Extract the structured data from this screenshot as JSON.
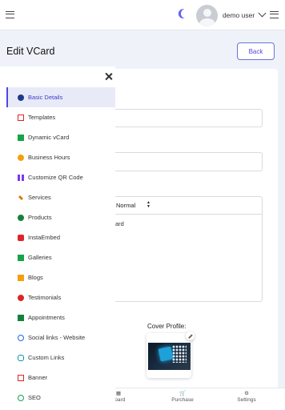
{
  "header": {
    "user_name": "demo user",
    "icons": {
      "menu": "hamburger-icon",
      "theme": "moon-icon",
      "user_menu": "chevron-down-icon",
      "options": "more-menu-icon"
    }
  },
  "page": {
    "title": "Edit VCard",
    "back_label": "Back"
  },
  "form": {
    "editor_format": "Normal",
    "editor_text": "ard",
    "cover_label": "Cover Profile:"
  },
  "sidebar": {
    "items": [
      {
        "label": "Basic Details",
        "icon": "question-circle-icon",
        "color": "#1e3a8a",
        "active": true
      },
      {
        "label": "Templates",
        "icon": "template-icon",
        "color": "#dc2626"
      },
      {
        "label": "Dynamic vCard",
        "icon": "dynamic-vcard-icon",
        "color": "#16a34a"
      },
      {
        "label": "Business Hours",
        "icon": "clock-icon",
        "color": "#f59e0b"
      },
      {
        "label": "Customize QR Code",
        "icon": "qr-code-icon",
        "color": "#7c3aed"
      },
      {
        "label": "Services",
        "icon": "wrench-icon",
        "color": "#d97706"
      },
      {
        "label": "Products",
        "icon": "product-icon",
        "color": "#15803d"
      },
      {
        "label": "InstaEmbed",
        "icon": "instagram-icon",
        "color": "#dc2626"
      },
      {
        "label": "Galleries",
        "icon": "gallery-icon",
        "color": "#16a34a"
      },
      {
        "label": "Blogs",
        "icon": "blog-icon",
        "color": "#f59e0b"
      },
      {
        "label": "Testimonials",
        "icon": "comment-icon",
        "color": "#dc2626"
      },
      {
        "label": "Appointments",
        "icon": "calendar-icon",
        "color": "#15803d"
      },
      {
        "label": "Social links - Website",
        "icon": "globe-icon",
        "color": "#2563eb"
      },
      {
        "label": "Custom Links",
        "icon": "link-icon",
        "color": "#0891b2"
      },
      {
        "label": "Banner",
        "icon": "banner-icon",
        "color": "#dc2626"
      },
      {
        "label": "SEO",
        "icon": "search-icon",
        "color": "#16a34a"
      }
    ]
  },
  "bottom_nav": {
    "items": [
      {
        "label": "Dashboard",
        "visible_label": "board",
        "icon": "dashboard-icon"
      },
      {
        "label": "Purchase",
        "icon": "cart-icon"
      },
      {
        "label": "Settings",
        "icon": "gear-icon"
      }
    ]
  },
  "colors": {
    "accent": "#4f46e5",
    "background": "#eff3f9",
    "active_item_bg": "#e8eaf8"
  }
}
